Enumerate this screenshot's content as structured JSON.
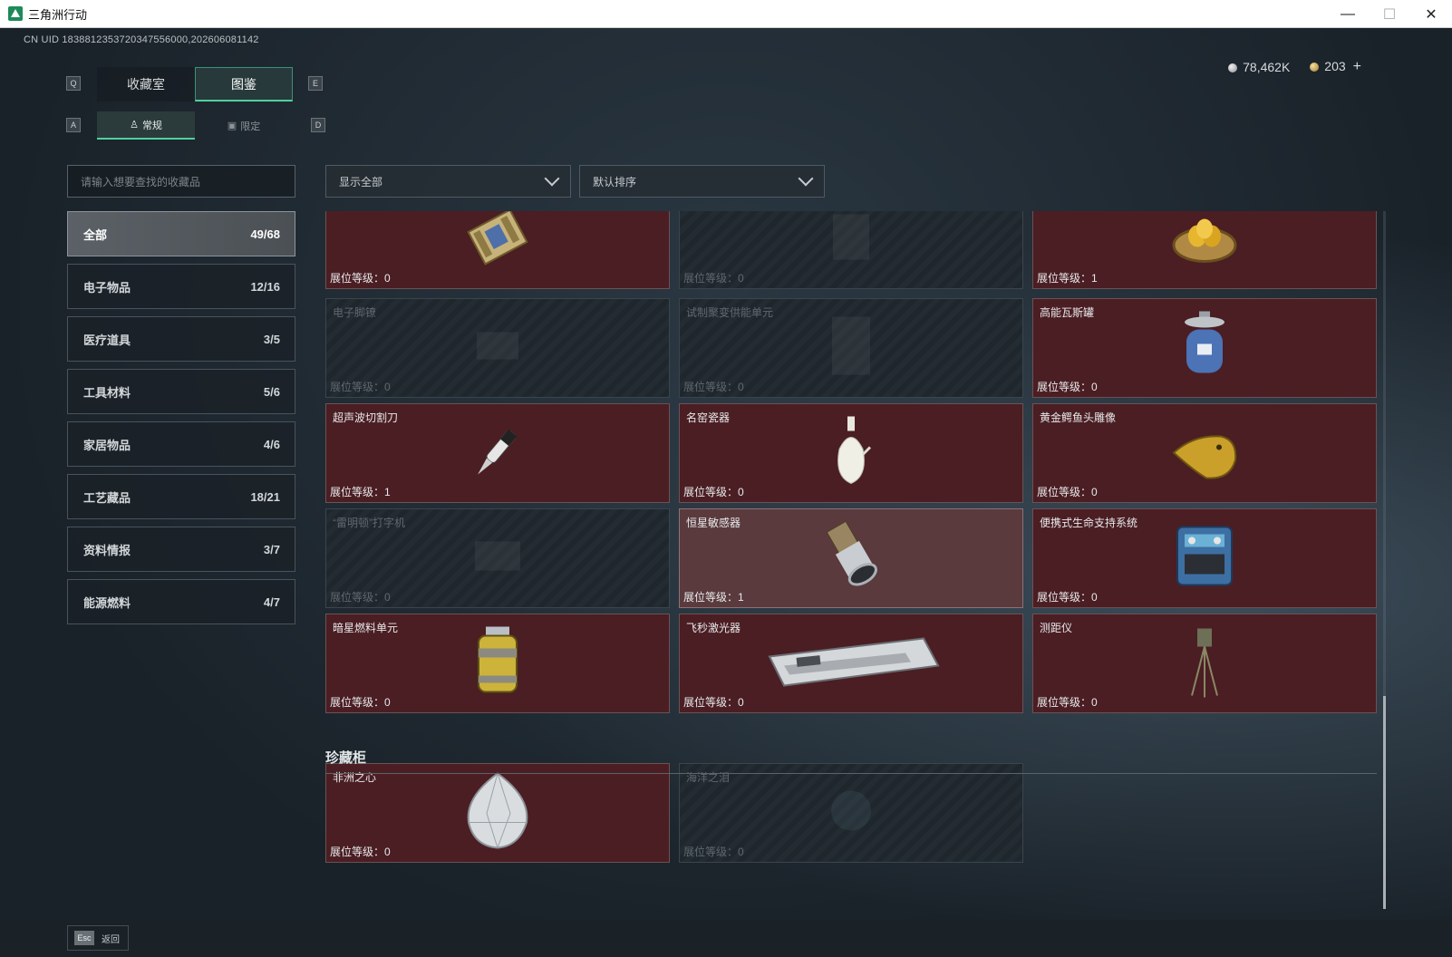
{
  "window": {
    "title": "三角洲行动"
  },
  "uid": "CN UID 1838812353720347556000,202606081142",
  "currency": {
    "silver": "78,462K",
    "gold": "203"
  },
  "keys": {
    "left_tab": "Q",
    "right_tab": "E",
    "left_sub": "A",
    "right_sub": "D",
    "esc": "Esc"
  },
  "tabs": [
    {
      "label": "收藏室"
    },
    {
      "label": "图鉴"
    }
  ],
  "subtabs": [
    {
      "label": "常规"
    },
    {
      "label": "限定"
    }
  ],
  "search": {
    "placeholder": "请输入想要查找的收藏品"
  },
  "filters": {
    "show": "显示全部",
    "sort": "默认排序"
  },
  "categories": [
    {
      "label": "全部",
      "count": "49/68"
    },
    {
      "label": "电子物品",
      "count": "12/16"
    },
    {
      "label": "医疗道具",
      "count": "3/5"
    },
    {
      "label": "工具材料",
      "count": "5/6"
    },
    {
      "label": "家居物品",
      "count": "4/6"
    },
    {
      "label": "工艺藏品",
      "count": "18/21"
    },
    {
      "label": "资料情报",
      "count": "3/7"
    },
    {
      "label": "能源燃料",
      "count": "4/7"
    }
  ],
  "level_prefix": "展位等级：",
  "items": [
    {
      "name": "",
      "level": "0",
      "locked": false,
      "icon": "circuit-board-icon"
    },
    {
      "name": "",
      "level": "0",
      "locked": true,
      "icon": "locked-item-icon"
    },
    {
      "name": "",
      "level": "1",
      "locked": false,
      "icon": "golden-nest-icon"
    },
    {
      "name": "电子脚镣",
      "level": "0",
      "locked": true,
      "icon": "ankle-monitor-icon"
    },
    {
      "name": "试制聚变供能单元",
      "level": "0",
      "locked": true,
      "icon": "fusion-unit-icon"
    },
    {
      "name": "高能瓦斯罐",
      "level": "0",
      "locked": false,
      "icon": "gas-canister-icon"
    },
    {
      "name": "超声波切割刀",
      "level": "1",
      "locked": false,
      "icon": "ultrasonic-cutter-icon"
    },
    {
      "name": "名窑瓷器",
      "level": "0",
      "locked": false,
      "icon": "porcelain-vase-icon"
    },
    {
      "name": "黄金鳄鱼头雕像",
      "level": "0",
      "locked": false,
      "icon": "gold-crocodile-statue-icon"
    },
    {
      "name": "“雷明顿”打字机",
      "level": "0",
      "locked": true,
      "icon": "typewriter-icon"
    },
    {
      "name": "恒星敏感器",
      "level": "1",
      "locked": false,
      "icon": "star-sensor-icon",
      "highlight": true
    },
    {
      "name": "便携式生命支持系统",
      "level": "0",
      "locked": false,
      "icon": "life-support-icon"
    },
    {
      "name": "暗星燃料单元",
      "level": "0",
      "locked": false,
      "icon": "fuel-cell-icon"
    },
    {
      "name": "飞秒激光器",
      "level": "0",
      "locked": false,
      "icon": "femtosecond-laser-icon"
    },
    {
      "name": "测距仪",
      "level": "0",
      "locked": false,
      "icon": "rangefinder-icon"
    }
  ],
  "treasure": {
    "title": "珍藏柜",
    "items": [
      {
        "name": "非洲之心",
        "level": "0",
        "locked": false,
        "icon": "diamond-icon"
      },
      {
        "name": "海洋之泪",
        "level": "0",
        "locked": true,
        "icon": "ocean-tear-icon"
      }
    ]
  },
  "footer": {
    "back_label": "返回"
  }
}
